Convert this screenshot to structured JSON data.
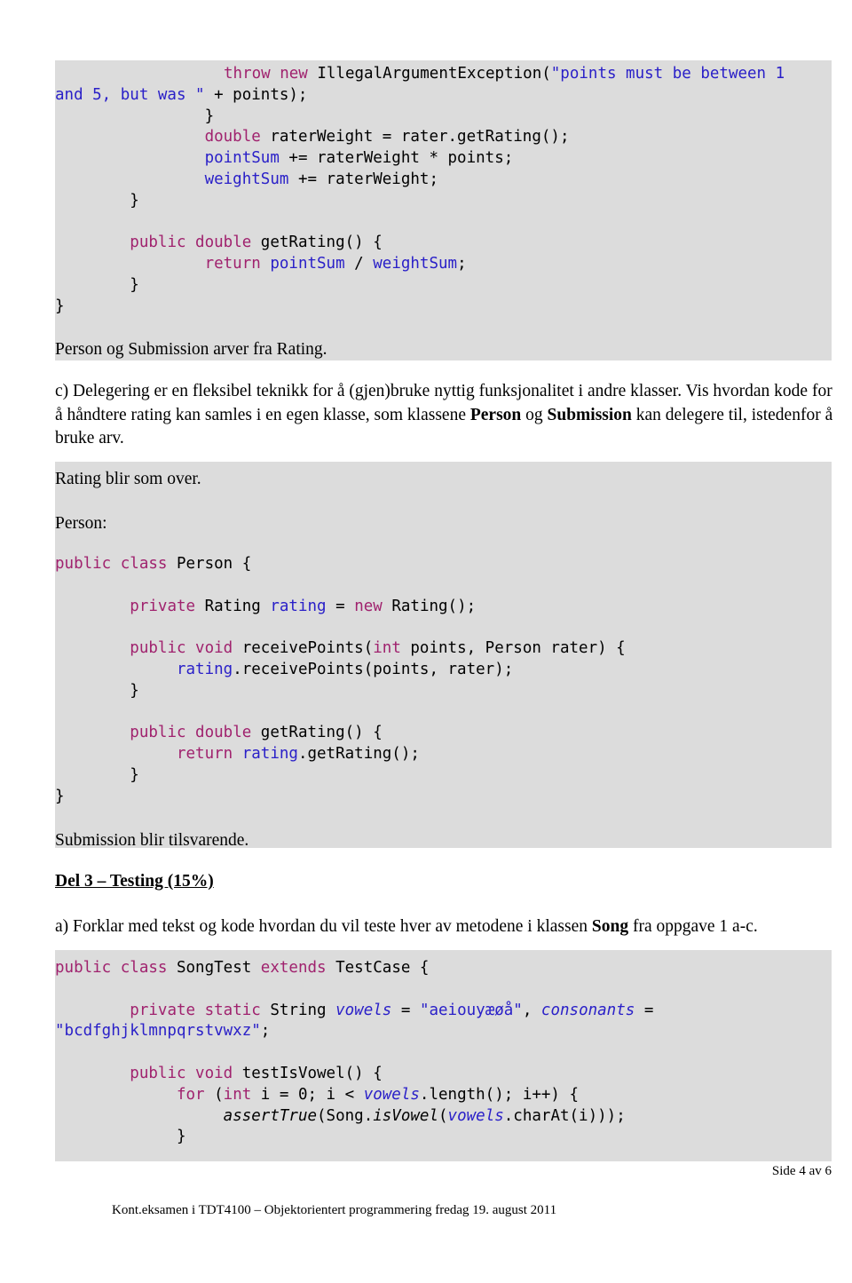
{
  "document": {
    "page_label": "Side 4 av 6",
    "footer": "Kont.eksamen i TDT4100 – Objektorientert programmering fredag 19. august 2011"
  },
  "colors": {
    "highlight_band": "#dcdcdc",
    "keyword": "#a0226e",
    "string_literal": "#2a20c8",
    "field_name": "#2a20c8",
    "text": "#000000",
    "page_background": "#ffffff"
  },
  "code_rating": {
    "lines": [
      "                throw new IllegalArgumentException(\"points must be between 1 and 5, but was \" + points);",
      "            }",
      "            double raterWeight = rater.getRating();",
      "            pointSum += raterWeight * points;",
      "            weightSum += raterWeight;",
      "        }",
      "",
      "        public double getRating() {",
      "            return pointSum / weightSum;",
      "        }",
      "}"
    ]
  },
  "prose": {
    "arver": "Person og Submission arver fra Rating.",
    "task_c_part1": "c) Delegering er en fleksibel teknikk for å (gjen)bruke nyttig funksjonalitet i andre klasser. Vis hvordan kode for å håndtere rating kan samles i en egen klasse, som klassene ",
    "task_c_bold1": "Person",
    "task_c_part2": " og ",
    "task_c_bold2": "Submission",
    "task_c_part3": " kan delegere til, istedenfor å bruke arv.",
    "rating_blir": "Rating blir som over.",
    "person_label": "Person:",
    "submission_blir": "Submission blir tilsvarende.",
    "del3_heading": "Del 3 – Testing (15%)",
    "task_a_part1": "a) Forklar med tekst og kode hvordan du vil teste hver av metodene i klassen ",
    "task_a_bold": "Song",
    "task_a_part2": " fra oppgave 1 a-c."
  },
  "code_person": {
    "lines": [
      "public class Person {",
      "",
      "      private Rating rating = new Rating();",
      "",
      "      public void receivePoints(int points, Person rater) {",
      "          rating.receivePoints(points, rater);",
      "      }",
      "",
      "      public double getRating() {",
      "          return rating.getRating();",
      "      }",
      "}"
    ]
  },
  "code_songtest": {
    "lines": [
      "public class SongTest extends TestCase {",
      "",
      "      private static String vowels = \"aeiouyæøå\", consonants = \"bcdfghjklmnpqrstvwxz\";",
      "",
      "      public void testIsVowel() {",
      "          for (int i = 0; i < vowels.length(); i++) {",
      "              assertTrue(Song.isVowel(vowels.charAt(i)));",
      "          }"
    ]
  }
}
